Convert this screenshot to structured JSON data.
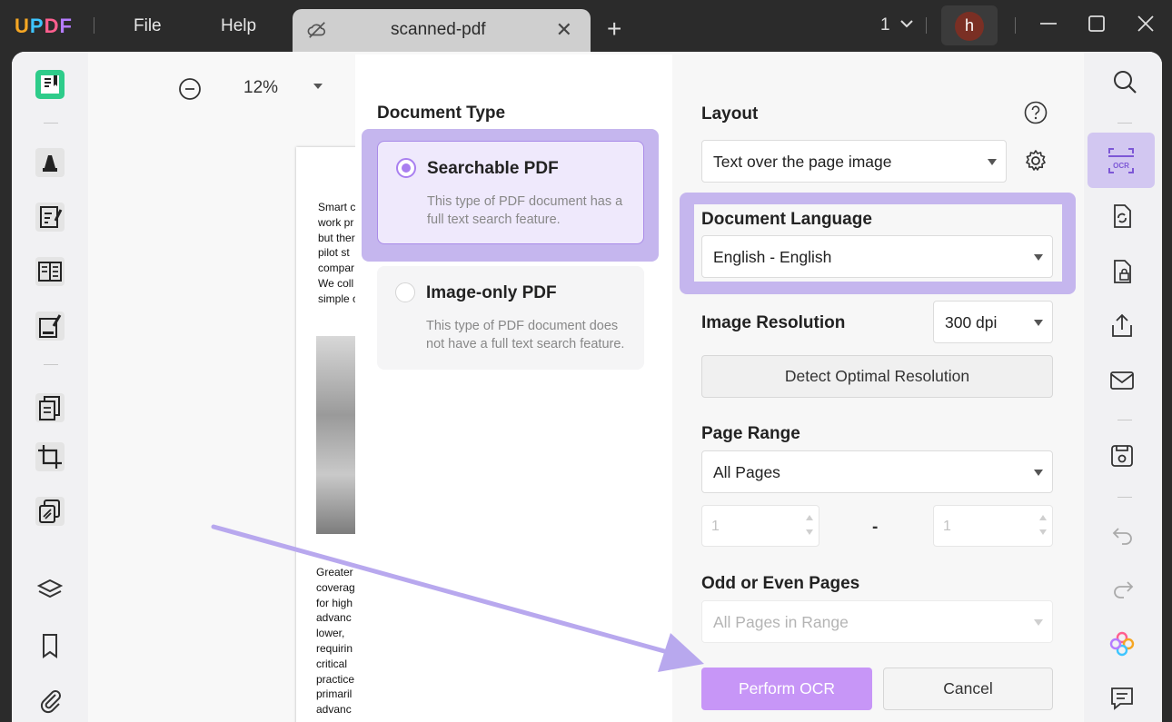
{
  "app": {
    "logo": "UPDF",
    "menu": [
      "File",
      "Help"
    ],
    "tab_title": "scanned-pdf",
    "page_count": "1",
    "avatar_letter": "h"
  },
  "toolbar": {
    "zoom": "12%"
  },
  "document_preview": {
    "lines_top": [
      "Smart c",
      "work pr",
      "but ther",
      "pilot st",
      "compar",
      "We coll",
      "simple c"
    ],
    "lines_bottom": [
      "Greater",
      "coverag",
      "for  high",
      "advanc",
      "lower,",
      "requirin",
      "critical",
      "practice",
      "primaril",
      "advanc"
    ]
  },
  "ocr_panel": {
    "document_type": {
      "title": "Document Type",
      "options": [
        {
          "label": "Searchable PDF",
          "description": "This type of PDF document has a full text search feature.",
          "selected": true
        },
        {
          "label": "Image-only PDF",
          "description": "This type of PDF document does not have a full text search feature.",
          "selected": false
        }
      ]
    },
    "layout": {
      "title": "Layout",
      "value": "Text over the page image"
    },
    "language": {
      "title": "Document Language",
      "value": "English - English"
    },
    "resolution": {
      "title": "Image Resolution",
      "value": "300 dpi",
      "detect_button": "Detect Optimal Resolution"
    },
    "page_range": {
      "title": "Page Range",
      "value": "All Pages",
      "from": "1",
      "separator": "-",
      "to": "1"
    },
    "odd_even": {
      "title": "Odd or Even Pages",
      "value": "All Pages in Range"
    },
    "buttons": {
      "perform": "Perform OCR",
      "cancel": "Cancel"
    }
  },
  "colors": {
    "accent": "#c796f7",
    "highlight": "#c5b6ee",
    "titlebar": "#2b2b2b"
  },
  "icons": {
    "left_toolbar": [
      "reader-icon",
      "highlighter-icon",
      "edit-pdf-icon",
      "form-icon",
      "sign-edit-icon",
      "organize-pages-icon",
      "crop-icon",
      "batch-icon",
      "layers-icon",
      "bookmark-icon",
      "attachment-icon"
    ],
    "right_toolbar": [
      "search-icon",
      "ocr-icon",
      "convert-icon",
      "protect-icon",
      "share-icon",
      "email-icon",
      "save-icon",
      "undo-icon",
      "redo-icon",
      "ai-icon",
      "comment-icon"
    ]
  }
}
